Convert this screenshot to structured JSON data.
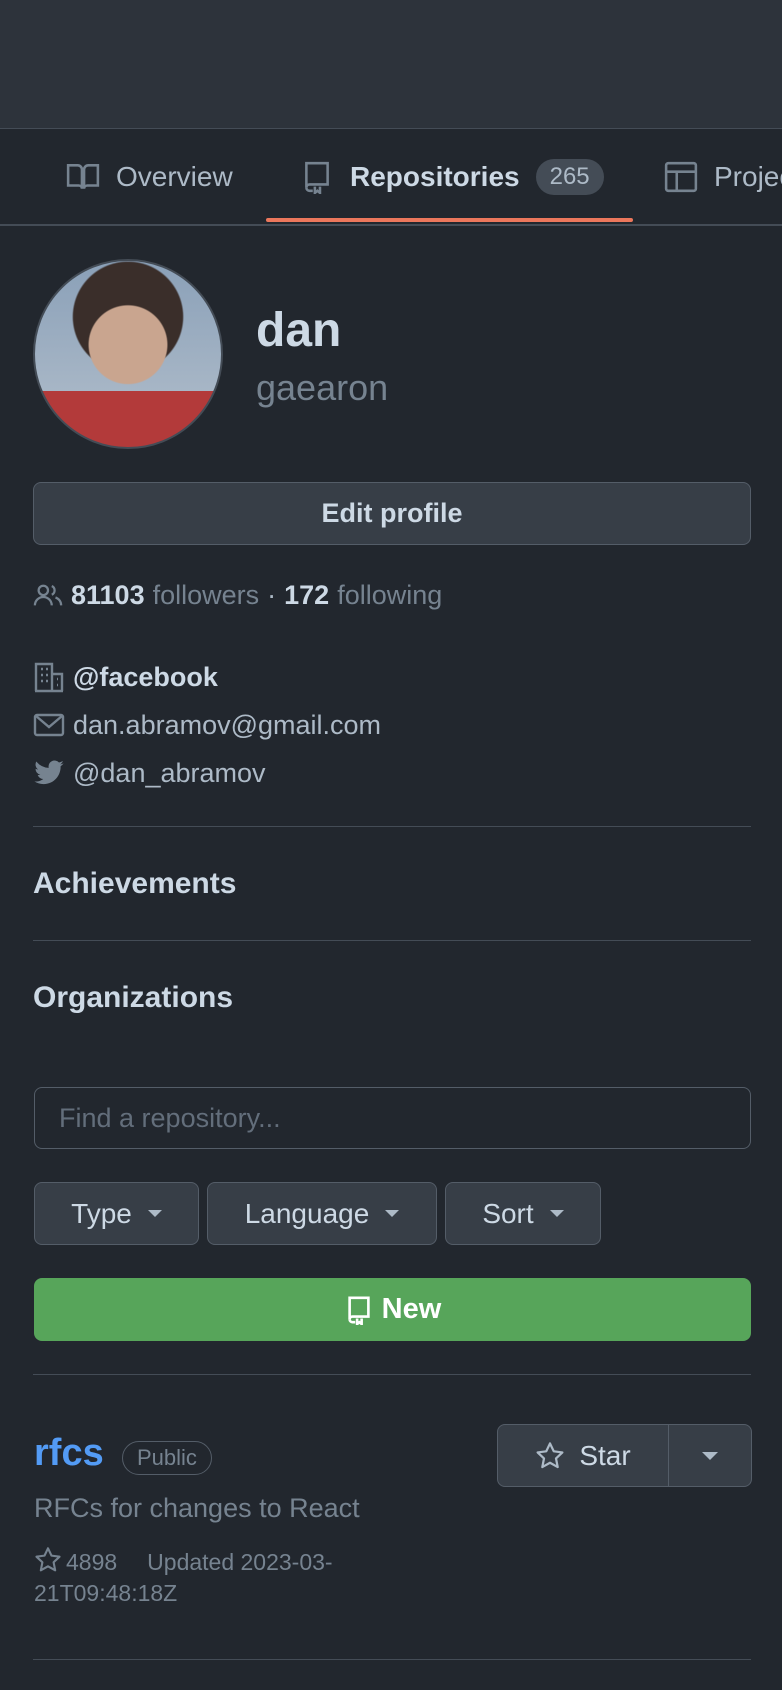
{
  "tabs": [
    {
      "label": "Overview",
      "icon": "book-icon"
    },
    {
      "label": "Repositories",
      "icon": "repo-icon",
      "counter": "265"
    },
    {
      "label": "Projec",
      "icon": "table-icon"
    }
  ],
  "profile": {
    "name": "dan",
    "login": "gaearon",
    "edit_label": "Edit profile",
    "followers_count": "81103",
    "followers_label": "followers",
    "dot": "·",
    "following_count": "172",
    "following_label": "following",
    "org": "@facebook",
    "email": "dan.abramov@gmail.com",
    "twitter": "@dan_abramov"
  },
  "sections": {
    "achievements": "Achievements",
    "organizations": "Organizations"
  },
  "search": {
    "placeholder": "Find a repository..."
  },
  "filters": {
    "type": "Type",
    "language": "Language",
    "sort": "Sort"
  },
  "new_label": "New",
  "repo": {
    "name": "rfcs",
    "visibility": "Public",
    "description": "RFCs for changes to React",
    "stars": "4898",
    "updated": "Updated 2023-03-21T09:48:18Z",
    "star_label": "Star"
  },
  "colors": {
    "background": "#22272e",
    "accent_underline": "#ec775c",
    "link": "#539bf5",
    "new_button": "#57a55a"
  }
}
